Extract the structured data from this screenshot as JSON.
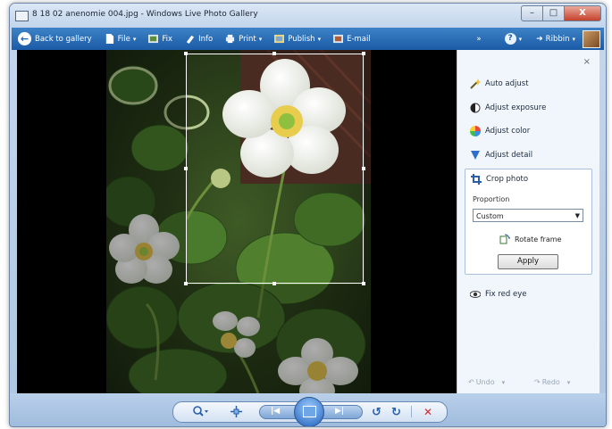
{
  "window": {
    "title": "8 18 02 anenomie 004.jpg - Windows Live Photo Gallery",
    "controls": {
      "minimize": "–",
      "maximize": "□",
      "close": "X"
    }
  },
  "toolbar": {
    "back_label": "Back to gallery",
    "file_label": "File",
    "fix_label": "Fix",
    "info_label": "Info",
    "print_label": "Print",
    "publish_label": "Publish",
    "email_label": "E-mail",
    "more_label": "»",
    "help_label": "?",
    "sign_in_label": "Ribbin",
    "caret": "▾"
  },
  "panel": {
    "close": "×",
    "auto_adjust": "Auto adjust",
    "adjust_exposure": "Adjust exposure",
    "adjust_color": "Adjust color",
    "adjust_detail": "Adjust detail",
    "crop": {
      "title": "Crop photo",
      "proportion_label": "Proportion",
      "proportion_value": "Custom",
      "rotate_label": "Rotate frame",
      "apply_label": "Apply"
    },
    "fix_red_eye": "Fix red eye",
    "undo_label": "Undo",
    "redo_label": "Redo",
    "caret": "▾"
  },
  "bottombar": {
    "zoom_icon": "magnifier-icon",
    "actual_size_icon": "actual-size-icon",
    "prev_icon": "previous-icon",
    "slideshow_icon": "slideshow-icon",
    "next_icon": "next-icon",
    "rotate_ccw_icon": "rotate-counterclockwise-icon",
    "rotate_cw_icon": "rotate-clockwise-icon",
    "delete_icon": "delete-icon"
  },
  "colors": {
    "toolbar_blue": "#1f5fab",
    "panel_bg": "#f1f6fd",
    "delete_red": "#d42a2a",
    "crop_handle": "#ffffff"
  }
}
